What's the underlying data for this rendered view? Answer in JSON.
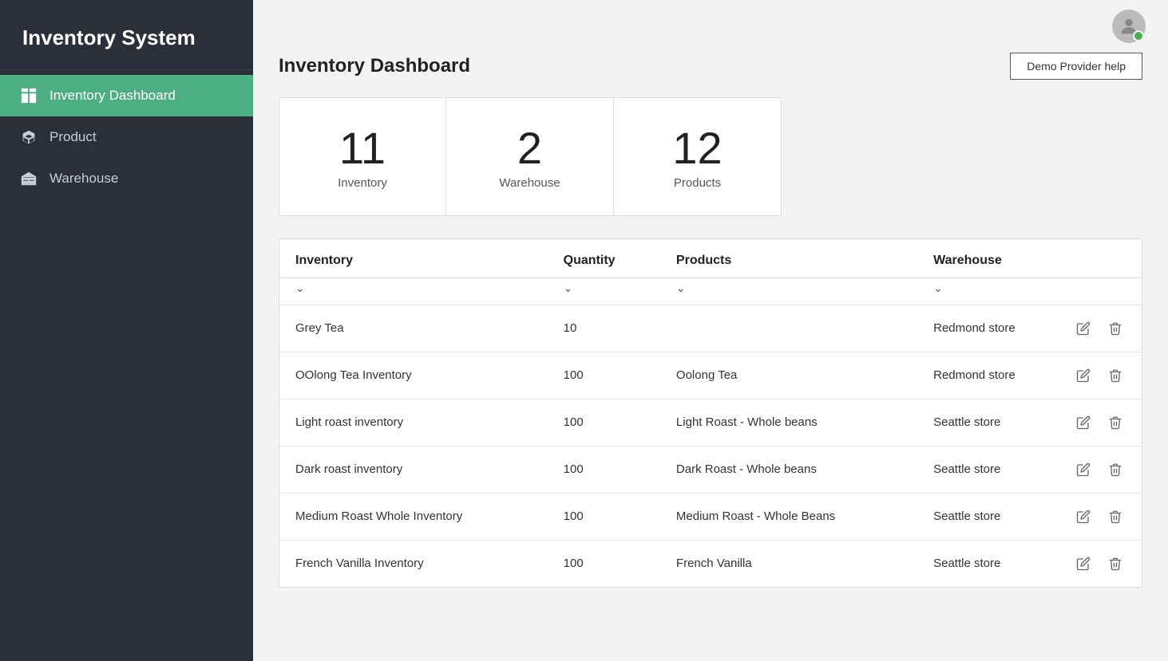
{
  "sidebar": {
    "title": "Inventory System",
    "nav": [
      {
        "id": "dashboard",
        "label": "Inventory Dashboard",
        "icon": "dashboard-icon",
        "active": true
      },
      {
        "id": "product",
        "label": "Product",
        "icon": "product-icon",
        "active": false
      },
      {
        "id": "warehouse",
        "label": "Warehouse",
        "icon": "warehouse-icon",
        "active": false
      }
    ]
  },
  "header": {
    "title": "Inventory Dashboard",
    "demo_help_label": "Demo Provider help"
  },
  "stats": [
    {
      "id": "inventory-stat",
      "number": "11",
      "label": "Inventory"
    },
    {
      "id": "warehouse-stat",
      "number": "2",
      "label": "Warehouse"
    },
    {
      "id": "products-stat",
      "number": "12",
      "label": "Products"
    }
  ],
  "table": {
    "columns": [
      {
        "id": "inventory",
        "label": "Inventory",
        "has_filter": true
      },
      {
        "id": "quantity",
        "label": "Quantity",
        "has_filter": true
      },
      {
        "id": "products",
        "label": "Products",
        "has_filter": true
      },
      {
        "id": "warehouse",
        "label": "Warehouse",
        "has_filter": true
      }
    ],
    "rows": [
      {
        "inventory": "Grey Tea",
        "quantity": "10",
        "products": "",
        "warehouse": "Redmond store"
      },
      {
        "inventory": "OOlong Tea Inventory",
        "quantity": "100",
        "products": "Oolong Tea",
        "warehouse": "Redmond store"
      },
      {
        "inventory": "Light roast inventory",
        "quantity": "100",
        "products": "Light Roast - Whole beans",
        "warehouse": "Seattle store"
      },
      {
        "inventory": "Dark roast inventory",
        "quantity": "100",
        "products": "Dark Roast - Whole beans",
        "warehouse": "Seattle store"
      },
      {
        "inventory": "Medium Roast Whole Inventory",
        "quantity": "100",
        "products": "Medium Roast - Whole Beans",
        "warehouse": "Seattle store"
      },
      {
        "inventory": "French Vanilla Inventory",
        "quantity": "100",
        "products": "French Vanilla",
        "warehouse": "Seattle store"
      }
    ]
  }
}
